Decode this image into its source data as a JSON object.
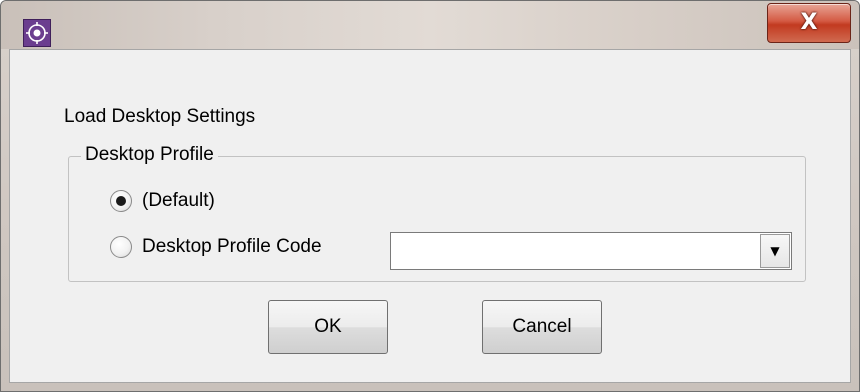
{
  "window": {
    "title": "",
    "close_glyph": "X"
  },
  "dialog": {
    "heading": "Load Desktop Settings"
  },
  "profile_group": {
    "legend": "Desktop Profile",
    "options": [
      {
        "label": "(Default)",
        "selected": true
      },
      {
        "label": "Desktop Profile Code",
        "selected": false
      }
    ],
    "profile_code_value": "",
    "dropdown_arrow": "▼"
  },
  "buttons": {
    "ok_label": "OK",
    "cancel_label": "Cancel"
  },
  "icons": {
    "app": "app-icon",
    "close": "close-icon",
    "dropdown": "chevron-down-icon"
  },
  "colors": {
    "close_button": "#c23a20",
    "dialog_background": "#f0f0f0",
    "app_icon": "#6b3e8f"
  }
}
